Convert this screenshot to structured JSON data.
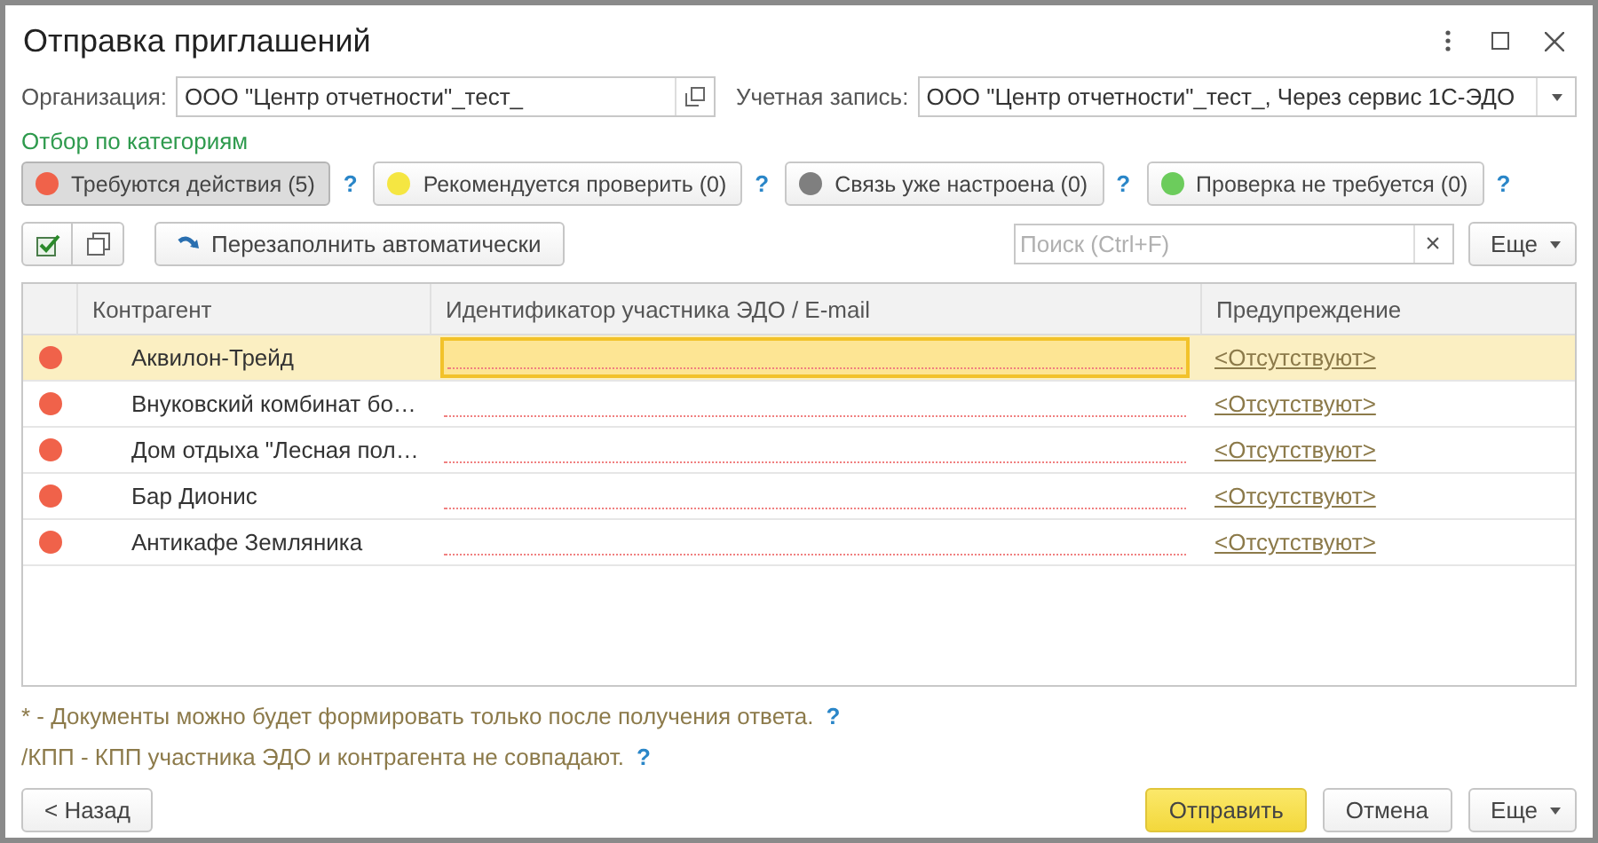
{
  "window": {
    "title": "Отправка приглашений"
  },
  "organization": {
    "label": "Организация:",
    "value": "ООО \"Центр отчетности\"_тест_"
  },
  "account": {
    "label": "Учетная запись:",
    "value": "ООО \"Центр отчетности\"_тест_, Через сервис 1С-ЭДО"
  },
  "filter_title": "Отбор по категориям",
  "filters": [
    {
      "label": "Требуются действия (5)",
      "color": "#f0624a",
      "selected": true,
      "help": "?"
    },
    {
      "label": "Рекомендуется проверить (0)",
      "color": "#f5e642",
      "selected": false,
      "help": "?"
    },
    {
      "label": "Связь уже настроена (0)",
      "color": "#7f7f7f",
      "selected": false,
      "help": "?"
    },
    {
      "label": "Проверка не требуется (0)",
      "color": "#6ccc5c",
      "selected": false,
      "help": "?"
    }
  ],
  "toolbar": {
    "refill_button": "Перезаполнить автоматически",
    "search": {
      "placeholder": "Поиск (Ctrl+F)",
      "clear": "×"
    },
    "more_button": "Еще"
  },
  "table": {
    "columns": [
      "Контрагент",
      "Идентификатор участника ЭДО / E-mail",
      "Предупреждение"
    ],
    "rows": [
      {
        "color": "#f0624a",
        "name": "Аквилон-Трейд",
        "warning": "<Отсутствуют>",
        "selected": true
      },
      {
        "color": "#f0624a",
        "name": "Внуковский комбинат бо…",
        "warning": "<Отсутствуют>",
        "selected": false
      },
      {
        "color": "#f0624a",
        "name": "Дом отдыха \"Лесная пол…",
        "warning": "<Отсутствуют>",
        "selected": false
      },
      {
        "color": "#f0624a",
        "name": "Бар Дионис",
        "warning": "<Отсутствуют>",
        "selected": false
      },
      {
        "color": "#f0624a",
        "name": "Антикафе Земляника",
        "warning": "<Отсутствуют>",
        "selected": false
      }
    ]
  },
  "notes": [
    {
      "text": "* - Документы можно будет формировать только после получения ответа.",
      "help": "?"
    },
    {
      "text": "/КПП - КПП участника ЭДО и контрагента не совпадают.",
      "help": "?"
    }
  ],
  "buttons": {
    "back": "< Назад",
    "send": "Отправить",
    "cancel": "Отмена",
    "more": "Еще"
  }
}
